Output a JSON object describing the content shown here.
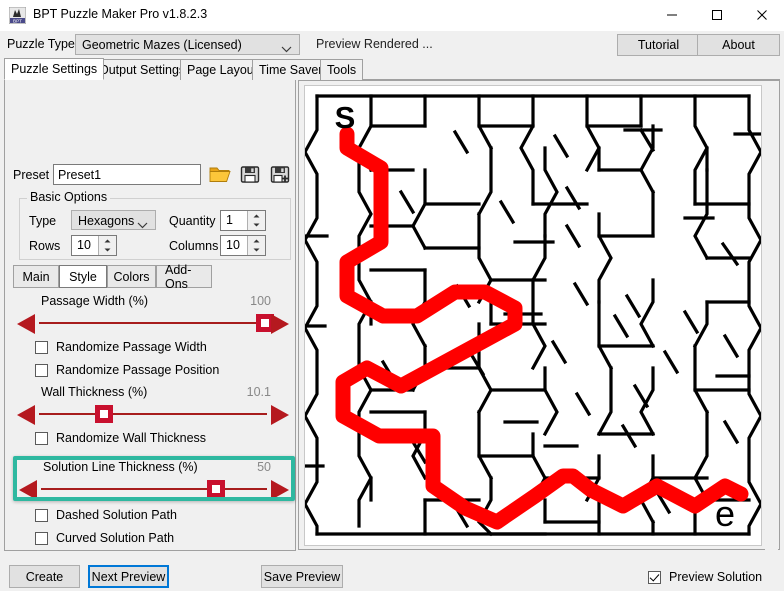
{
  "window": {
    "title": "BPT Puzzle Maker Pro v1.8.2.3",
    "app_icon": "app-icon",
    "minimize_icon": "minimize-icon",
    "maximize_icon": "maximize-icon",
    "close_icon": "close-icon"
  },
  "toolbar": {
    "puzzle_type_label": "Puzzle Type",
    "puzzle_type_value": "Geometric Mazes (Licensed)",
    "status_text": "Preview Rendered ...",
    "tutorial_label": "Tutorial",
    "about_label": "About"
  },
  "tabs": {
    "items": [
      {
        "label": "Puzzle Settings",
        "selected": true
      },
      {
        "label": "Output Settings",
        "selected": false
      },
      {
        "label": "Page Layout",
        "selected": false
      },
      {
        "label": "Time Saver",
        "selected": false
      },
      {
        "label": "Tools",
        "selected": false
      }
    ]
  },
  "preset": {
    "label": "Preset",
    "value": "Preset1",
    "placeholder": "",
    "open_icon": "folder-open-icon",
    "save_icon": "floppy-save-icon",
    "save_as_icon": "floppy-save-as-icon"
  },
  "basic_options": {
    "group_title": "Basic Options",
    "type_label": "Type",
    "type_value": "Hexagons",
    "quantity_label": "Quantity",
    "quantity_value": "1",
    "rows_label": "Rows",
    "rows_value": "10",
    "columns_label": "Columns",
    "columns_value": "10"
  },
  "subtabs": {
    "items": [
      {
        "label": "Main",
        "selected": false
      },
      {
        "label": "Style",
        "selected": true
      },
      {
        "label": "Colors",
        "selected": false
      },
      {
        "label": "Add-Ons",
        "selected": false
      }
    ]
  },
  "style_panel": {
    "passage_width": {
      "label": "Passage Width (%)",
      "value": "100",
      "thumb_pct": 100
    },
    "randomize_passage_width": {
      "label": "Randomize Passage Width",
      "checked": false
    },
    "randomize_passage_position": {
      "label": "Randomize Passage Position",
      "checked": false
    },
    "wall_thickness": {
      "label": "Wall Thickness (%)",
      "value": "10.1",
      "thumb_pct": 27
    },
    "randomize_wall_thickness": {
      "label": "Randomize Wall Thickness",
      "checked": false
    },
    "solution_line_thickness": {
      "label": "Solution Line Thickness (%)",
      "value": "50",
      "thumb_pct": 77
    },
    "dashed_solution_path": {
      "label": "Dashed Solution Path",
      "checked": false
    },
    "curved_solution_path": {
      "label": "Curved Solution Path",
      "checked": false
    },
    "highlight_color": "#2eb8a0",
    "slider_color": "#c8102e"
  },
  "preview": {
    "maze_type": "hexagons",
    "start_marker": "S",
    "end_marker": "e",
    "solution_color": "#ff0000",
    "wall_color": "#000000",
    "background_color": "#ffffff"
  },
  "bottom": {
    "create_label": "Create",
    "next_preview_label": "Next Preview",
    "save_preview_label": "Save Preview",
    "preview_solution_label": "Preview Solution",
    "preview_solution_checked": true
  }
}
